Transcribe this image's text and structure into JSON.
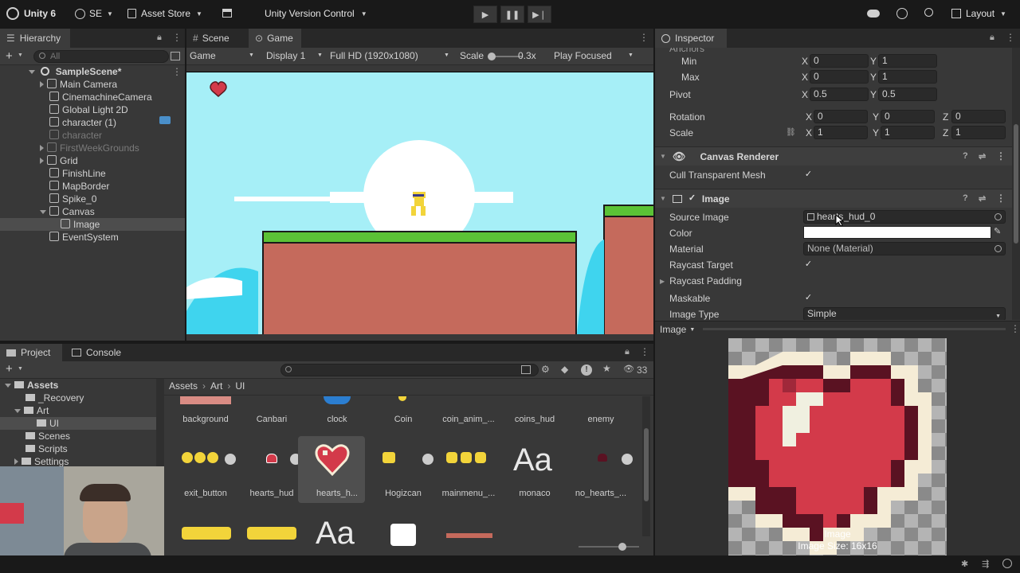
{
  "toolbar": {
    "app_title": "Unity 6",
    "account": "SE",
    "asset_store": "Asset Store",
    "version_control": "Unity Version Control",
    "layout": "Layout"
  },
  "hierarchy": {
    "tab": "Hierarchy",
    "search_placeholder": "All",
    "scene": "SampleScene*",
    "items": [
      {
        "label": "Main Camera"
      },
      {
        "label": "CinemachineCamera"
      },
      {
        "label": "Global Light 2D"
      },
      {
        "label": "character (1)"
      },
      {
        "label": "character"
      },
      {
        "label": "FirstWeekGrounds"
      },
      {
        "label": "Grid"
      },
      {
        "label": "FinishLine"
      },
      {
        "label": "MapBorder"
      },
      {
        "label": "Spike_0"
      },
      {
        "label": "Canvas"
      },
      {
        "label": "Image"
      },
      {
        "label": "EventSystem"
      }
    ]
  },
  "game_view": {
    "tab_scene": "Scene",
    "tab_game": "Game",
    "mode": "Game",
    "display": "Display 1",
    "resolution": "Full HD (1920x1080)",
    "scale_label": "Scale",
    "scale_value": "0.3x",
    "play_focused": "Play Focused"
  },
  "inspector": {
    "tab": "Inspector",
    "anchors_label": "Anchors",
    "min_label": "Min",
    "min_x": "0",
    "min_y": "1",
    "max_label": "Max",
    "max_x": "0",
    "max_y": "1",
    "pivot_label": "Pivot",
    "pivot_x": "0.5",
    "pivot_y": "0.5",
    "rotation_label": "Rotation",
    "rot_x": "0",
    "rot_y": "0",
    "rot_z": "0",
    "scale_label": "Scale",
    "scale_x": "1",
    "scale_y": "1",
    "scale_z": "1",
    "axis_x": "X",
    "axis_y": "Y",
    "axis_z": "Z",
    "canvas_renderer": "Canvas Renderer",
    "cull_transparent": "Cull Transparent Mesh",
    "image_component": "Image",
    "source_image_label": "Source Image",
    "source_image_value": "hearts_hud_0",
    "color_label": "Color",
    "material_label": "Material",
    "material_value": "None (Material)",
    "raycast_target": "Raycast Target",
    "raycast_padding": "Raycast Padding",
    "maskable": "Maskable",
    "image_type_label": "Image Type",
    "image_type_value": "Simple",
    "preview_dropdown": "Image",
    "preview_caption": "Image",
    "preview_size": "Image Size: 16x16"
  },
  "project": {
    "tab_project": "Project",
    "tab_console": "Console",
    "badge_count": "33",
    "breadcrumb": [
      "Assets",
      "Art",
      "UI"
    ],
    "tree": [
      {
        "label": "Assets"
      },
      {
        "label": "_Recovery"
      },
      {
        "label": "Art"
      },
      {
        "label": "UI"
      },
      {
        "label": "Scenes"
      },
      {
        "label": "Scripts"
      },
      {
        "label": "Settings"
      }
    ],
    "assets_row1": [
      "background",
      "Canbari",
      "clock",
      "Coin",
      "coin_anim_...",
      "coins_hud",
      "enemy"
    ],
    "assets_row2": [
      "exit_button",
      "hearts_hud",
      "hearts_h...",
      "Hogizcan",
      "mainmenu_...",
      "monaco",
      "no_hearts_..."
    ]
  },
  "colors": {
    "accent": "#2c5d87",
    "heart_red": "#d33a4a",
    "sky": "#a6eff7"
  }
}
